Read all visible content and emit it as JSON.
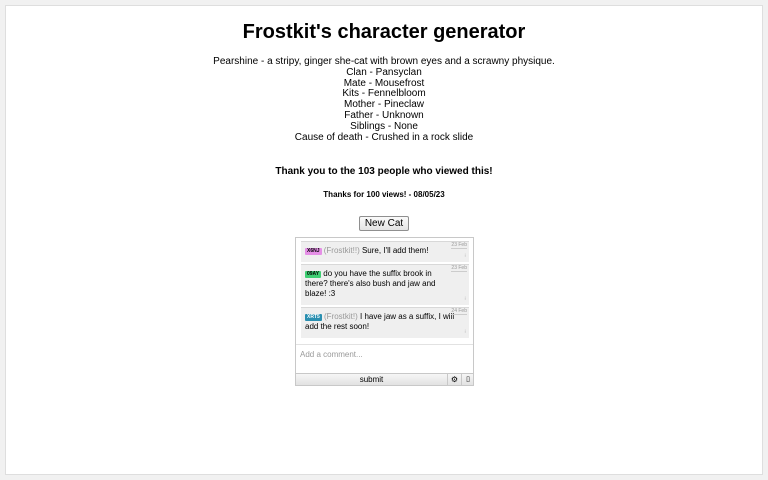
{
  "title": "Frostkit's character generator",
  "character": {
    "description": "Pearshine - a stripy, ginger she-cat with brown eyes and a scrawny physique.",
    "lines": [
      "Clan - Pansyclan",
      "Mate - Mousefrost",
      "Kits - Fennelbloom",
      "Mother - Pineclaw",
      "Father - Unknown",
      "Siblings - None",
      "Cause of death - Crushed in a rock slide"
    ]
  },
  "thanks_views": "Thank you to the 103 people who viewed this!",
  "thanks_100": "Thanks for 100 views! - 08/05/23",
  "new_cat_label": "New Cat",
  "chat": {
    "messages": [
      {
        "tag": "X6NJ",
        "tag_color": "#e58fe6",
        "mention": "(Frostkit!!)",
        "text": " Sure, I'll add them!",
        "date": "23 Feb"
      },
      {
        "tag": "09AY",
        "tag_color": "#3fcf73",
        "mention": "",
        "text": " do you have the suffix brook in there? there's also bush and jaw and blaze! :3",
        "date": "23 Feb"
      },
      {
        "tag": "XRT5",
        "tag_color": "#2a8fb0",
        "mention": "(Frostkit!)",
        "text": " I have jaw as a suffix, I will add the rest soon!",
        "date": "24 Feb"
      }
    ],
    "comment_placeholder": "Add a comment...",
    "submit_label": "submit",
    "settings_icon": "gear-icon",
    "info_icon": "info-icon"
  }
}
